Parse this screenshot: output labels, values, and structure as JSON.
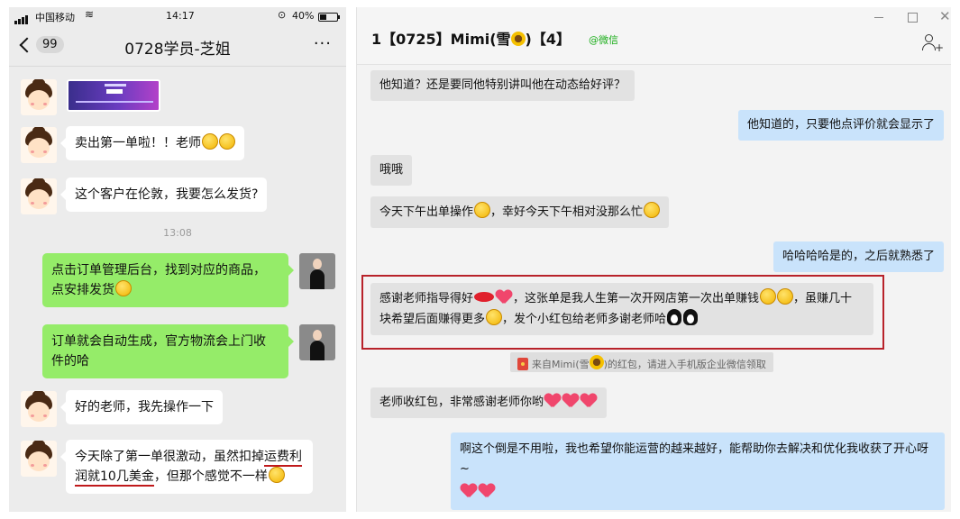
{
  "phone": {
    "status": {
      "carrier": "中国移动",
      "time": "14:17",
      "battery": "40%",
      "battery_level": 0.4
    },
    "nav": {
      "back_count": "99",
      "title": "0728学员-芝姐",
      "more": "···"
    },
    "timestamp": "13:08",
    "messages": [
      {
        "text": "卖出第一单啦！！老师"
      },
      {
        "text": "这个客户在伦敦，我要怎么发货?"
      },
      {
        "line1": "点击订单管理后台，找到对应的商品，",
        "line2": "点安排发货"
      },
      {
        "line1": "订单就会自动生成，官方物流会上门收",
        "line2": "件的哈"
      },
      {
        "text": "好的老师，我先操作一下"
      },
      {
        "l1a": "今天除了第一单很激动，虽然扣掉",
        "l1b": "运费利",
        "l2a": "润就10几美金",
        "l2b": "，但那个感觉不一样"
      }
    ]
  },
  "desktop": {
    "title": "1【0725】Mimi(雪",
    "title_tail": ")【4】",
    "tag": "@微信",
    "window": {
      "minimize": "—",
      "close": "✕"
    },
    "messages": [
      {
        "text": "他知道？还是要同他特别讲叫他在动态给好评？"
      },
      {
        "text": "他知道的，只要他点评价就会显示了"
      },
      {
        "text": "哦哦"
      },
      {
        "a": "今天下午出单操作",
        "b": "，幸好今天下午相对没那么忙"
      },
      {
        "text": "哈哈哈哈是的，之后就熟悉了"
      },
      {
        "a": "感谢老师指导得好",
        "b": "，这张单是我人生第一次开网店第一次出单赚钱",
        "c": "，虽赚几十",
        "d": "块希望后面赚得更多",
        "e": "，发个小红包给老师多谢老师哈"
      },
      {
        "text": "老师收红包，非常感谢老师你哟"
      },
      {
        "text": "啊这个倒是不用啦，我也希望你能运营的越来越好，能帮助你去解决和优化我收获了开心呀~"
      }
    ],
    "redpacket": {
      "pre": "来自Mimi(雪",
      "post": ")的红包，请进入手机版企业微信领取"
    }
  }
}
